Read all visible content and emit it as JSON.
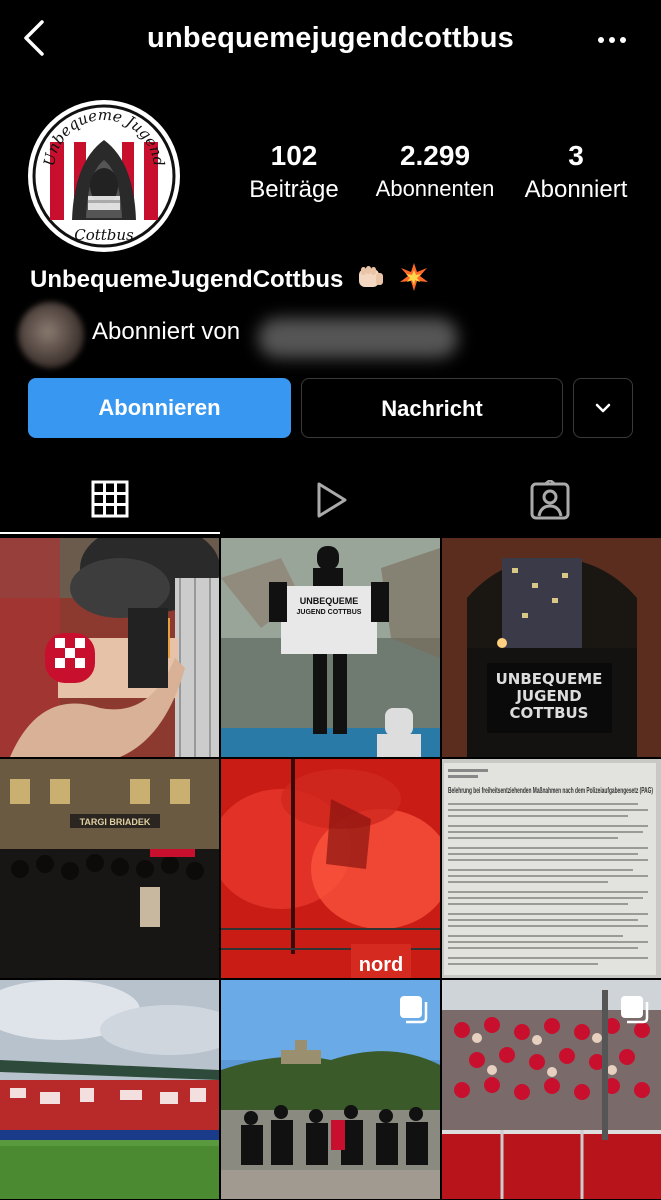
{
  "header": {
    "username": "unbequemejugendcottbus",
    "back_icon": "chevron-left-icon",
    "more_icon": "more-horizontal-icon"
  },
  "profile": {
    "avatar_text_top": "Unbequeme Jugend",
    "avatar_text_bottom": "Cottbus",
    "display_name": "UnbequemeJugendCottbus",
    "emojis": [
      "fist-emoji",
      "collision-emoji"
    ]
  },
  "stats": [
    {
      "number": "102",
      "label": "Beiträge"
    },
    {
      "number": "2.299",
      "label": "Abonnenten"
    },
    {
      "number": "3",
      "label": "Abonniert"
    }
  ],
  "followed_by": {
    "label": "Abonniert von"
  },
  "actions": {
    "follow_label": "Abonnieren",
    "message_label": "Nachricht",
    "follow_color": "#3897f0"
  },
  "tabs": [
    {
      "icon": "grid-icon",
      "active": true
    },
    {
      "icon": "reels-play-icon",
      "active": false
    },
    {
      "icon": "tagged-person-icon",
      "active": false
    }
  ],
  "posts": [
    {
      "name": "post-1-pyro-smoke",
      "multi": false
    },
    {
      "name": "post-2-shirt-banner",
      "multi": false,
      "shirt_text": [
        "UNBEQUEME",
        "JUGEND COTTBUS"
      ]
    },
    {
      "name": "post-3-night-banner",
      "multi": false,
      "banner_text": [
        "UNBEQUEME",
        "JUGEND",
        "COTTBUS"
      ]
    },
    {
      "name": "post-4-group-photo",
      "multi": false,
      "sign_text": "TARGI BRIADEK"
    },
    {
      "name": "post-5-red-flares",
      "multi": false,
      "banner_text": "nord"
    },
    {
      "name": "post-6-document",
      "multi": false,
      "doc_title": "Belehrung bei freiheitsentziehenden Maßnahmen nach dem Polizeiaufgabengesetz (PAG)"
    },
    {
      "name": "post-7-stadium",
      "multi": false
    },
    {
      "name": "post-8-outdoor-group",
      "multi": true
    },
    {
      "name": "post-9-fan-block",
      "multi": true
    }
  ]
}
